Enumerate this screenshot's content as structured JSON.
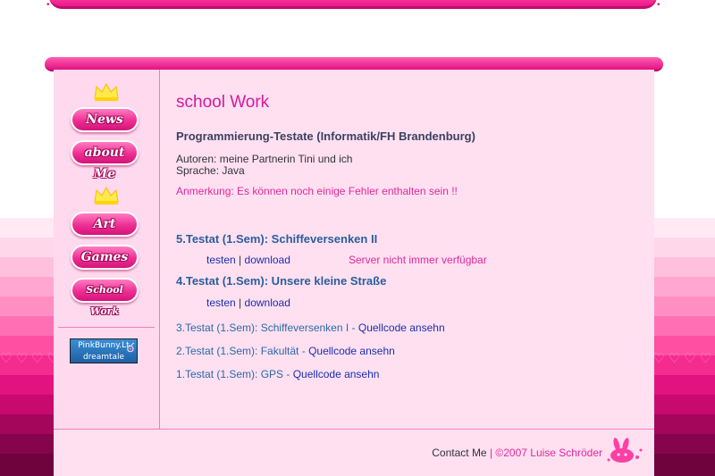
{
  "page": {
    "title": "school Work",
    "section_title": "Programmierung-Testate (Informatik/FH Brandenburg)",
    "authors": "Autoren: meine Partnerin Tini und ich",
    "language": "Sprache: Java",
    "note": "Anmerkung: Es können noch einige Fehler enthalten sein !!"
  },
  "nav": {
    "news": "News",
    "about": "about Me",
    "art": "Art",
    "games": "Games",
    "school": "School Work"
  },
  "badge": {
    "line1": "PinkBunny.Lt",
    "line2": "dreamtale"
  },
  "tasks": [
    {
      "title": "5.Testat (1.Sem): Schiffeversenken II",
      "test": "testen",
      "separator": "|",
      "download": "download",
      "server_note": "Server nicht immer verfügbar"
    },
    {
      "title": "4.Testat (1.Sem): Unsere kleine Straße",
      "test": "testen",
      "separator": "|",
      "download": "download"
    }
  ],
  "old_tasks": [
    {
      "label": "3.Testat (1.Sem): Schiffeversenken I - ",
      "link": "Quellcode ansehn"
    },
    {
      "label": "2.Testat (1.Sem): Fakultät - ",
      "link": "Quellcode ansehn"
    },
    {
      "label": "1.Testat (1.Sem): GPS - ",
      "link": "Quellcode ansehn"
    }
  ],
  "footer": {
    "contact": "Contact Me",
    "separator": " | ",
    "copyright": "©2007 Luise Schröder"
  },
  "colors": {
    "accent_pink": "#ee1789",
    "title_pink": "#d6189b",
    "link_blue": "#1a2fb0",
    "task_blue": "#2b5e9c"
  }
}
